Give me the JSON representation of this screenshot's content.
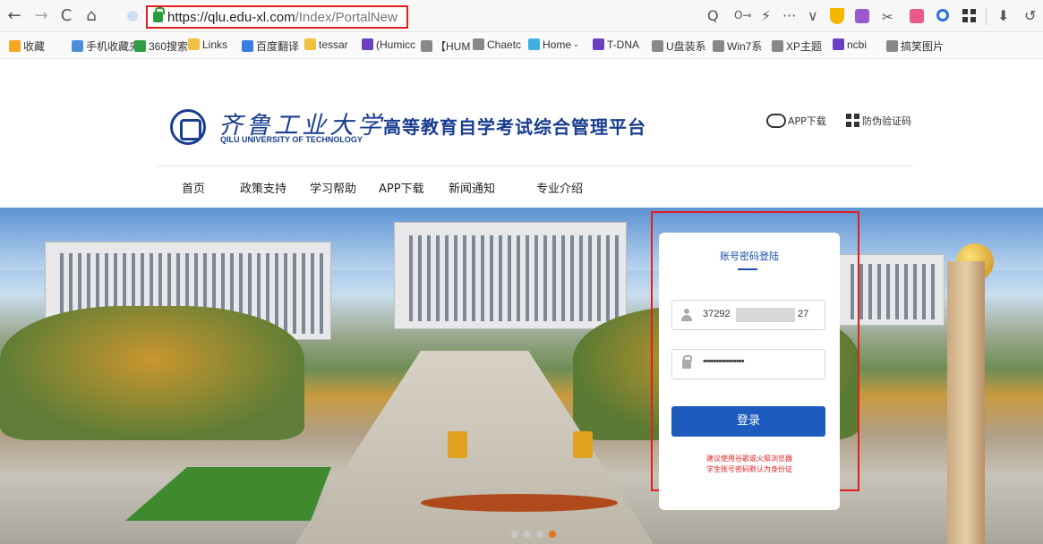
{
  "browser": {
    "url_host": "https://qlu.edu-xl.com",
    "url_path": "/Index/PortalNew",
    "nav": {
      "back": "←",
      "forward": "→",
      "reload": "C",
      "home": "⌂"
    },
    "right_icons": {
      "zoom": "Q",
      "key": "O⊸",
      "bolt": "⚡",
      "more": "···",
      "dropdown": "∨",
      "download": "⬇",
      "undo": "↺"
    }
  },
  "bookmarks": [
    {
      "label": "收藏",
      "color": "#f5a623"
    },
    {
      "label": "手机收藏夹",
      "color": "#4a90d9"
    },
    {
      "label": "360搜索",
      "color": "#2f9e44"
    },
    {
      "label": "Links",
      "color": "#f0c040"
    },
    {
      "label": "百度翻译",
      "color": "#3b7de0"
    },
    {
      "label": "tessar",
      "color": "#f0c040"
    },
    {
      "label": "(Humicc",
      "color": "#6a3fc0"
    },
    {
      "label": "【HUM",
      "color": "#888888"
    },
    {
      "label": "Chaetc",
      "color": "#888888"
    },
    {
      "label": "Home -",
      "color": "#3fb0e0"
    },
    {
      "label": "T-DNA",
      "color": "#6a3fc0"
    },
    {
      "label": "U盘装系",
      "color": "#888888"
    },
    {
      "label": "Win7系",
      "color": "#888888"
    },
    {
      "label": "XP主题",
      "color": "#888888"
    },
    {
      "label": "ncbi",
      "color": "#6a3fc0"
    },
    {
      "label": "搞笑图片",
      "color": "#888888"
    }
  ],
  "header": {
    "logo_cn": "齐鲁工业大学",
    "logo_en": "QILU UNIVERSITY OF TECHNOLOGY",
    "title": "高等教育自学考试综合管理平台",
    "app_download": "APP下载",
    "verify_code": "防伪验证码"
  },
  "menu": [
    "首页",
    "政策支持",
    "学习帮助",
    "APP下载",
    "新闻通知",
    "专业介绍"
  ],
  "login": {
    "tab": "账号密码登陆",
    "username_prefix": "37292",
    "username_suffix": "27",
    "password": "••••••••••••••••",
    "button": "登录",
    "note1": "建议使用谷歌或火狐浏览器",
    "note2": "学生账号密码默认为身份证"
  },
  "carousel": {
    "count": 4,
    "active_index": 3
  }
}
